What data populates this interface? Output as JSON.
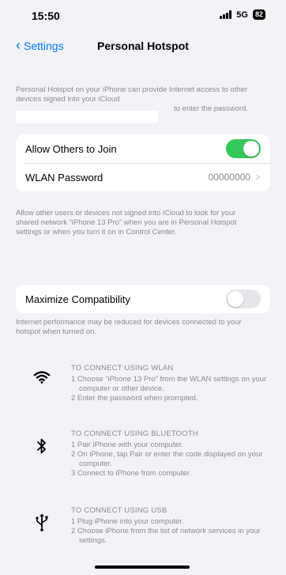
{
  "status": {
    "time": "15:50",
    "network": "5G",
    "battery": "82"
  },
  "nav": {
    "back_label": "Settings",
    "title": "Personal Hotspot"
  },
  "intro": "Personal Hotspot on your iPhone can provide Internet access to other devices signed into your iCloud",
  "intro_tail": "to enter the password.",
  "allow": {
    "label": "Allow Others to Join",
    "state": true
  },
  "password": {
    "label": "WLAN Password",
    "value": "00000000"
  },
  "allow_note": "Allow other users or devices not signed into iCloud to look for your shared network “iPhone 13 Pro” when you are in Personal Hotspot settings or when you turn it on in Control Center.",
  "maximize": {
    "label": "Maximize Compatibility",
    "state": false
  },
  "maximize_note": "Internet performance may be reduced for devices connected to your hotspot when turned on.",
  "connect": {
    "wlan": {
      "heading": "TO CONNECT USING WLAN",
      "steps": [
        "1 Choose “iPhone 13 Pro” from the WLAN settings on your computer or other device.",
        "2 Enter the password when prompted."
      ]
    },
    "bluetooth": {
      "heading": "TO CONNECT USING BLUETOOTH",
      "steps": [
        "1 Pair iPhone with your computer.",
        "2 On iPhone, tap Pair or enter the code displayed on your computer.",
        "3 Connect to iPhone from computer."
      ]
    },
    "usb": {
      "heading": "TO CONNECT USING USB",
      "steps": [
        "1 Plug iPhone into your computer.",
        "2 Choose iPhone from the list of network services in your settings."
      ]
    }
  },
  "icons": [
    "wifi-icon",
    "bluetooth-icon",
    "usb-icon",
    "chevron-left-icon",
    "chevron-right-icon"
  ],
  "colors": {
    "accent": "#007aff",
    "toggle_on": "#34c759"
  }
}
